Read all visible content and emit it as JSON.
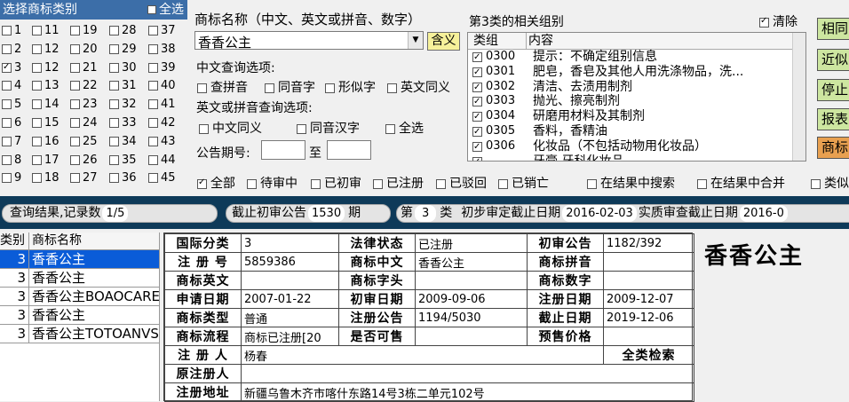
{
  "left_panel": {
    "title": "选择商标类别",
    "select_all": "全选",
    "classes": [
      [
        "1",
        "11",
        "19",
        "28",
        "37"
      ],
      [
        "2",
        "12",
        "20",
        "29",
        "38"
      ],
      [
        "3",
        "12",
        "21",
        "30",
        "39"
      ],
      [
        "4",
        "13",
        "22",
        "31",
        "40"
      ],
      [
        "5",
        "14",
        "23",
        "32",
        "41"
      ],
      [
        "6",
        "15",
        "24",
        "33",
        "42"
      ],
      [
        "7",
        "16",
        "25",
        "34",
        "43"
      ],
      [
        "8",
        "17",
        "26",
        "35",
        "44"
      ],
      [
        "9",
        "18",
        "27",
        "36",
        "45"
      ]
    ],
    "checked_class": "3"
  },
  "query": {
    "name_label": "商标名称（中文、英文或拼音、数字）",
    "name_value": "香香公主",
    "meaning_button": "含义",
    "cn_options_label": "中文查询选项:",
    "cn_options": [
      "查拼音",
      "同音字",
      "形似字",
      "英文同义"
    ],
    "en_options_label": "英文或拼音查询选项:",
    "en_options": [
      "中文同义",
      "同音汉字",
      "全选"
    ],
    "period_label": "公告期号:",
    "period_to": "至"
  },
  "groups": {
    "title": "第3类的相关组别",
    "clear_label": "清除",
    "col_group": "类组",
    "col_content": "内容",
    "rows": [
      {
        "code": "0300",
        "desc": "提示：不确定组别信息"
      },
      {
        "code": "0301",
        "desc": "肥皂，香皂及其他人用洗涤物品，洗..."
      },
      {
        "code": "0302",
        "desc": "清洁、去渍用制剂"
      },
      {
        "code": "0303",
        "desc": "抛光、擦亮制剂"
      },
      {
        "code": "0304",
        "desc": "研磨用材料及其制剂"
      },
      {
        "code": "0305",
        "desc": "香料，香精油"
      },
      {
        "code": "0306",
        "desc": "化妆品（不包括动物用化妆品）"
      },
      {
        "code": "",
        "desc": "牙膏 牙科化妆品"
      }
    ]
  },
  "side_buttons": [
    "相同",
    "近似",
    "停止",
    "报表",
    "商标"
  ],
  "filters": [
    "全部",
    "待审中",
    "已初审",
    "已注册",
    "已驳回",
    "已销亡"
  ],
  "filters2": [
    "在结果中搜索",
    "在结果中合并",
    "类似"
  ],
  "status_bar": {
    "result_label": "查询结果,记录数",
    "result_count": "1/5",
    "deadline_prefix": "截止初审公告",
    "deadline_period": "1530",
    "deadline_suffix": "期",
    "class_prefix": "第",
    "class_num": "3",
    "class_suffix": "类",
    "prelim_label": "初步审定截止日期",
    "prelim_date": "2016-02-03",
    "exam_label": "实质审查截止日期",
    "exam_date": "2016-0"
  },
  "results": {
    "col_class": "类别",
    "col_name": "商标名称",
    "rows": [
      {
        "cls": "3",
        "name": "香香公主"
      },
      {
        "cls": "3",
        "name": "香香公主"
      },
      {
        "cls": "3",
        "name": "香香公主BOAOCARE"
      },
      {
        "cls": "3",
        "name": "香香公主"
      },
      {
        "cls": "3",
        "name": "香香公主TOTOANVS"
      }
    ]
  },
  "detail": {
    "l_intl_class": "国际分类",
    "v_intl_class": "3",
    "l_legal": "法律状态",
    "v_legal": "已注册",
    "l_prelim_pub": "初审公告",
    "v_prelim_pub": "1182/392",
    "l_reg_no": "注 册 号",
    "v_reg_no": "5859386",
    "l_cn": "商标中文",
    "v_cn": "香香公主",
    "l_pinyin": "商标拼音",
    "v_pinyin": "",
    "l_en": "商标英文",
    "v_en": "",
    "l_head": "商标字头",
    "v_head": "",
    "l_num": "商标数字",
    "v_num": "",
    "l_apply": "申请日期",
    "v_apply": "2007-01-22",
    "l_prelim_date": "初审日期",
    "v_prelim_date": "2009-09-06",
    "l_reg_date": "注册日期",
    "v_reg_date": "2009-12-07",
    "l_type": "商标类型",
    "v_type": "普通",
    "l_reg_pub": "注册公告",
    "v_reg_pub": "1194/5030",
    "l_expire": "截止日期",
    "v_expire": "2019-12-06",
    "l_flow": "商标流程",
    "v_flow": "商标已注册[20",
    "l_sale": "是否可售",
    "v_sale": "",
    "l_price": "预售价格",
    "v_price": "",
    "l_registrant": "注 册 人",
    "v_registrant": "杨春",
    "all_search": "全类检索",
    "l_orig": "原注册人",
    "v_orig": "",
    "l_addr": "注册地址",
    "v_addr": "新疆乌鲁木齐市喀什东路14号3栋二单元102号"
  },
  "preview_name": "香香公主"
}
